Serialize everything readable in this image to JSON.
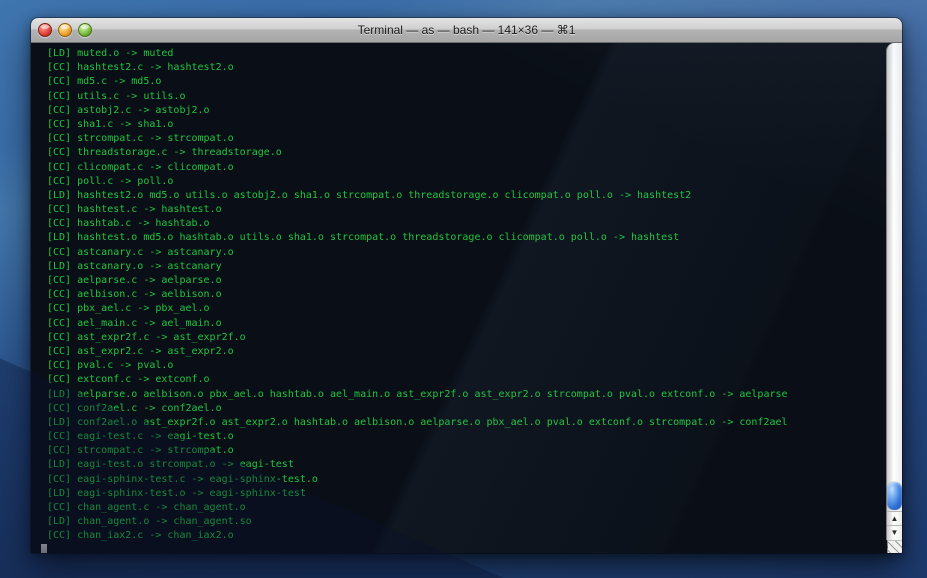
{
  "window": {
    "title": "Terminal — as — bash — 141×36 — ⌘1"
  },
  "terminal": {
    "colors": {
      "background": "#0a0f17",
      "text": "#21c53e",
      "cursor": "#a8a8a8"
    },
    "lines": [
      "[LD] muted.o -> muted",
      "[CC] hashtest2.c -> hashtest2.o",
      "[CC] md5.c -> md5.o",
      "[CC] utils.c -> utils.o",
      "[CC] astobj2.c -> astobj2.o",
      "[CC] sha1.c -> sha1.o",
      "[CC] strcompat.c -> strcompat.o",
      "[CC] threadstorage.c -> threadstorage.o",
      "[CC] clicompat.c -> clicompat.o",
      "[CC] poll.c -> poll.o",
      "[LD] hashtest2.o md5.o utils.o astobj2.o sha1.o strcompat.o threadstorage.o clicompat.o poll.o -> hashtest2",
      "[CC] hashtest.c -> hashtest.o",
      "[CC] hashtab.c -> hashtab.o",
      "[LD] hashtest.o md5.o hashtab.o utils.o sha1.o strcompat.o threadstorage.o clicompat.o poll.o -> hashtest",
      "[CC] astcanary.c -> astcanary.o",
      "[LD] astcanary.o -> astcanary",
      "[CC] aelparse.c -> aelparse.o",
      "[CC] aelbison.c -> aelbison.o",
      "[CC] pbx_ael.c -> pbx_ael.o",
      "[CC] ael_main.c -> ael_main.o",
      "[CC] ast_expr2f.c -> ast_expr2f.o",
      "[CC] ast_expr2.c -> ast_expr2.o",
      "[CC] pval.c -> pval.o",
      "[CC] extconf.c -> extconf.o",
      "[LD] aelparse.o aelbison.o pbx_ael.o hashtab.o ael_main.o ast_expr2f.o ast_expr2.o strcompat.o pval.o extconf.o -> aelparse",
      "[CC] conf2ael.c -> conf2ael.o",
      "[LD] conf2ael.o ast_expr2f.o ast_expr2.o hashtab.o aelbison.o aelparse.o pbx_ael.o pval.o extconf.o strcompat.o -> conf2ael",
      "[CC] eagi-test.c -> eagi-test.o",
      "[CC] strcompat.c -> strcompat.o",
      "[LD] eagi-test.o strcompat.o -> eagi-test",
      "[CC] eagi-sphinx-test.c -> eagi-sphinx-test.o",
      "[LD] eagi-sphinx-test.o -> eagi-sphinx-test",
      "[CC] chan_agent.c -> chan_agent.o",
      "[LD] chan_agent.o -> chan_agent.so",
      "[CC] chan_iax2.c -> chan_iax2.o"
    ]
  },
  "scrollbar": {
    "up_arrow": "▲",
    "down_arrow": "▼"
  },
  "colors": {
    "desktop_top": "#4076b0",
    "desktop_mid": "#2e5c9c",
    "desktop_bottom": "#1d3a6e",
    "titlebar_top": "#e4e4e4",
    "titlebar_bottom": "#a7a7a7",
    "traffic_close": "#e2453c",
    "traffic_minimize": "#f0a832",
    "traffic_zoom": "#7cc043",
    "scroll_thumb": "#2f6fd4"
  }
}
